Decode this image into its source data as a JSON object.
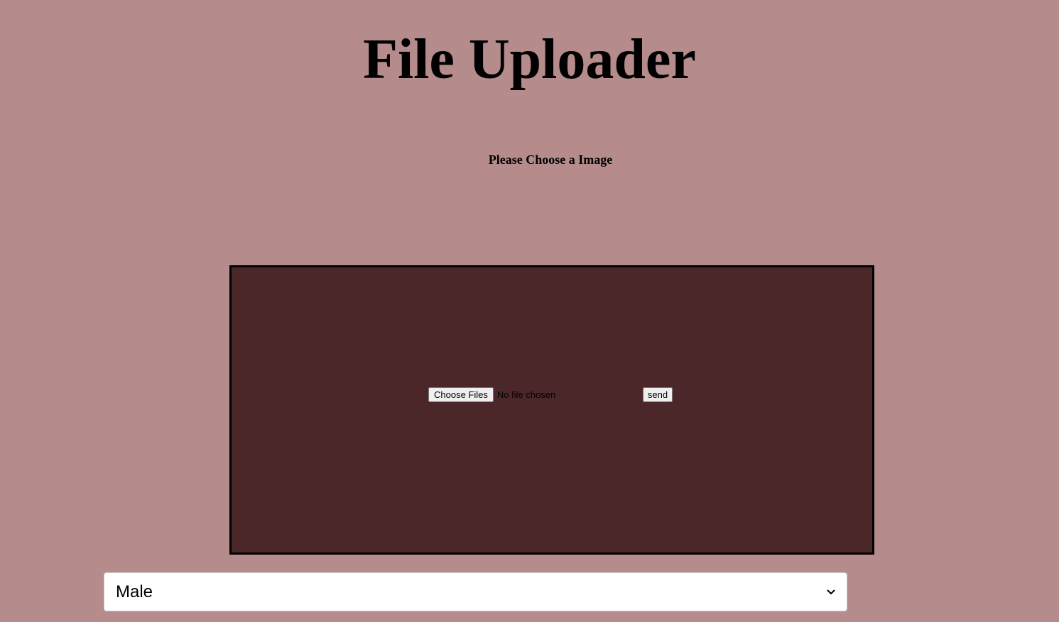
{
  "header": {
    "title": "File Uploader",
    "subtitle": "Please Choose a Image"
  },
  "uploader": {
    "choose_label": "Choose Files",
    "file_status": "No file chosen",
    "send_label": "send"
  },
  "gender_select": {
    "selected": "Male",
    "icon": "chevron-down-icon"
  },
  "colors": {
    "page_background": "#b58b8b",
    "panel_background": "#4c2729",
    "panel_border": "#000000"
  }
}
